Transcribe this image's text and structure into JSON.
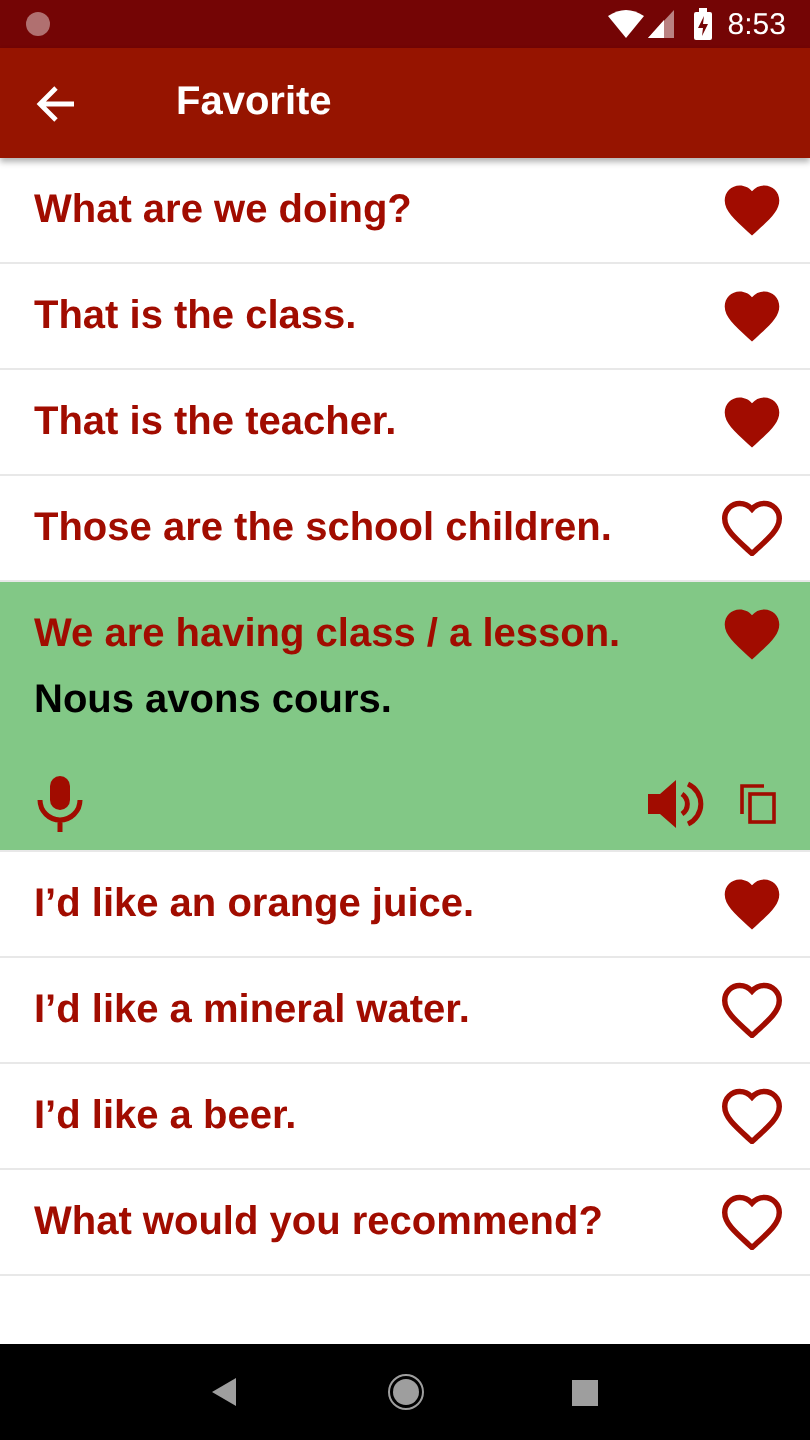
{
  "status_bar": {
    "time": "8:53"
  },
  "app_bar": {
    "title": "Favorite"
  },
  "phrases": [
    {
      "text": "What are we doing?",
      "favorite": true,
      "expanded": false
    },
    {
      "text": "That is the class.",
      "favorite": true,
      "expanded": false
    },
    {
      "text": "That is the teacher.",
      "favorite": true,
      "expanded": false
    },
    {
      "text": "Those are the school children.",
      "favorite": false,
      "expanded": false
    },
    {
      "text": "We are having class / a lesson.",
      "favorite": true,
      "expanded": true,
      "translation": "Nous avons cours."
    },
    {
      "text": "I’d like an orange juice.",
      "favorite": true,
      "expanded": false
    },
    {
      "text": "I’d like a mineral water.",
      "favorite": false,
      "expanded": false
    },
    {
      "text": "I’d like a beer.",
      "favorite": false,
      "expanded": false
    },
    {
      "text": "What would you recommend?",
      "favorite": false,
      "expanded": false
    }
  ]
}
